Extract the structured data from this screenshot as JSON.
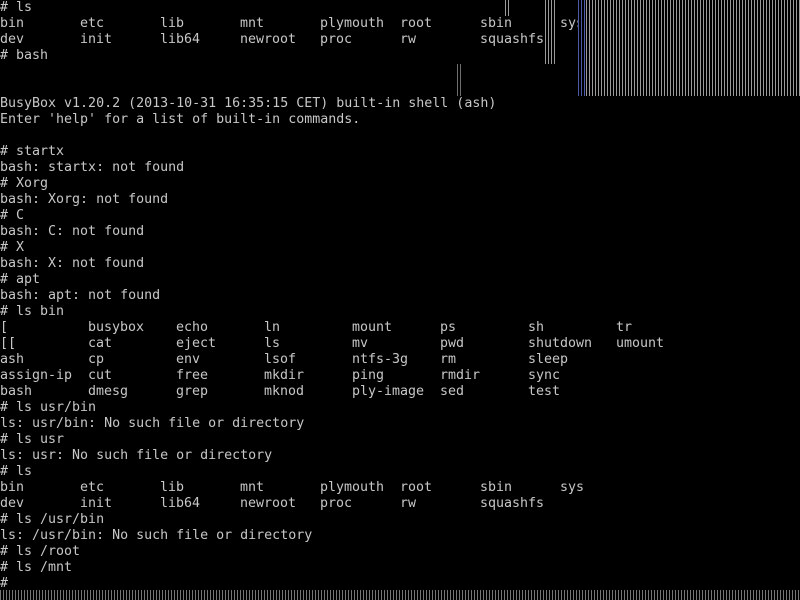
{
  "terminal": {
    "lines": [
      "# ls",
      [
        "bin",
        "etc",
        "lib",
        "mnt",
        "plymouth",
        "root",
        "sbin",
        "sys"
      ],
      [
        "dev",
        "init",
        "lib64",
        "newroot",
        "proc",
        "rw",
        "squashfs"
      ],
      "# bash",
      "",
      "",
      "BusyBox v1.20.2 (2013-10-31 16:35:15 CET) built-in shell (ash)",
      "Enter 'help' for a list of built-in commands.",
      "",
      "# startx",
      "bash: startx: not found",
      "# Xorg",
      "bash: Xorg: not found",
      "# C",
      "bash: C: not found",
      "# X",
      "bash: X: not found",
      "# apt",
      "bash: apt: not found",
      "# ls bin",
      [
        "[",
        "busybox",
        "echo",
        "ln",
        "mount",
        "ps",
        "sh",
        "tr"
      ],
      [
        "[[",
        "cat",
        "eject",
        "ls",
        "mv",
        "pwd",
        "shutdown",
        "umount"
      ],
      [
        "ash",
        "cp",
        "env",
        "lsof",
        "ntfs-3g",
        "rm",
        "sleep"
      ],
      [
        "assign-ip",
        "cut",
        "free",
        "mkdir",
        "ping",
        "rmdir",
        "sync"
      ],
      [
        "bash",
        "dmesg",
        "grep",
        "mknod",
        "ply-image",
        "sed",
        "test"
      ],
      "# ls usr/bin",
      "ls: usr/bin: No such file or directory",
      "# ls usr",
      "ls: usr: No such file or directory",
      "# ls",
      [
        "bin",
        "etc",
        "lib",
        "mnt",
        "plymouth",
        "root",
        "sbin",
        "sys"
      ],
      [
        "dev",
        "init",
        "lib64",
        "newroot",
        "proc",
        "rw",
        "squashfs"
      ],
      "# ls /usr/bin",
      "ls: /usr/bin: No such file or directory",
      "# ls /root",
      "# ls /mnt",
      "# "
    ]
  },
  "colors": {
    "background": "#000000",
    "text": "#c7c7c7"
  }
}
